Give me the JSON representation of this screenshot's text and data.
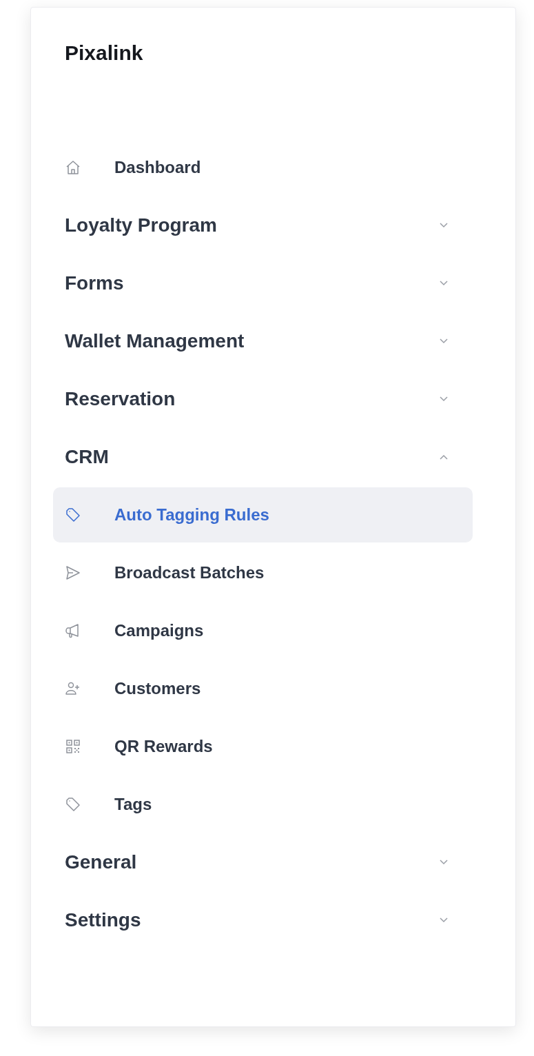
{
  "sidebar": {
    "brand": "Pixalink",
    "items": [
      {
        "kind": "link",
        "label": "Dashboard",
        "selected": false
      },
      {
        "kind": "group",
        "label": "Loyalty Program",
        "expanded": false
      },
      {
        "kind": "group",
        "label": "Forms",
        "expanded": false
      },
      {
        "kind": "group",
        "label": "Wallet Management",
        "expanded": false
      },
      {
        "kind": "group",
        "label": "Reservation",
        "expanded": false
      },
      {
        "kind": "group",
        "label": "CRM",
        "expanded": true,
        "children": [
          {
            "label": "Auto Tagging Rules",
            "selected": true
          },
          {
            "label": "Broadcast Batches",
            "selected": false
          },
          {
            "label": "Campaigns",
            "selected": false
          },
          {
            "label": "Customers",
            "selected": false
          },
          {
            "label": "QR Rewards",
            "selected": false
          },
          {
            "label": "Tags",
            "selected": false
          }
        ]
      },
      {
        "kind": "group",
        "label": "General",
        "expanded": false
      },
      {
        "kind": "group",
        "label": "Settings",
        "expanded": false
      }
    ]
  }
}
